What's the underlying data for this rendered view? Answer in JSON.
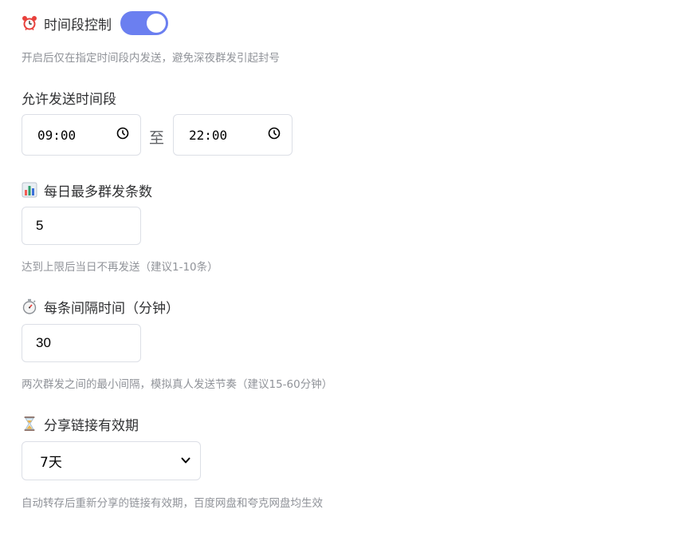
{
  "time_control": {
    "title": "时间段控制",
    "toggle_on": true,
    "accent_color": "#6b7ff0",
    "hint": "开启后仅在指定时间段内发送，避免深夜群发引起封号",
    "icon": "alarm-clock-icon"
  },
  "send_window": {
    "title": "允许发送时间段",
    "start_time": "09:00",
    "separator": "至",
    "end_time": "22:00",
    "icon": "clock-icon"
  },
  "daily_limit": {
    "title": "每日最多群发条数",
    "value": "5",
    "hint": "达到上限后当日不再发送（建议1-10条）",
    "icon": "bar-chart-icon"
  },
  "interval": {
    "title": "每条间隔时间（分钟）",
    "value": "30",
    "hint": "两次群发之间的最小间隔，模拟真人发送节奏（建议15-60分钟）",
    "icon": "stopwatch-icon"
  },
  "link_validity": {
    "title": "分享链接有效期",
    "selected": "7天",
    "hint": "自动转存后重新分享的链接有效期，百度网盘和夸克网盘均生效",
    "icon": "hourglass-icon"
  }
}
